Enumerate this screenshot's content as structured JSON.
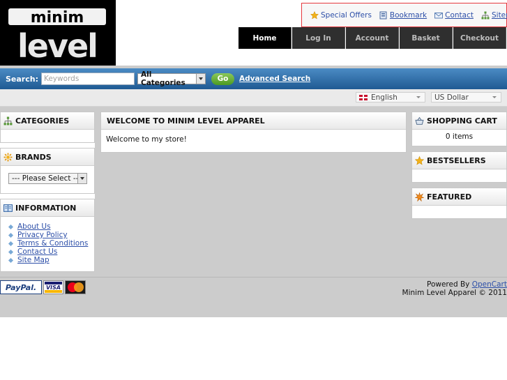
{
  "logo": {
    "line1": "minim",
    "line2": "level"
  },
  "toplinks": [
    {
      "label": "Special Offers",
      "icon": "star-icon"
    },
    {
      "label": "Bookmark",
      "icon": "bookmark-icon"
    },
    {
      "label": "Contact",
      "icon": "envelope-icon"
    },
    {
      "label": "Sitemap",
      "icon": "sitemap-icon"
    }
  ],
  "nav": {
    "home": "Home",
    "login": "Log In",
    "account": "Account",
    "basket": "Basket",
    "checkout": "Checkout"
  },
  "search": {
    "label": "Search:",
    "placeholder": "Keywords",
    "category": "All Categories",
    "go": "Go",
    "advanced": "Advanced Search"
  },
  "language": "English",
  "currency": "US Dollar",
  "left": {
    "categories_title": "CATEGORIES",
    "brands_title": "BRANDS",
    "brands_select": "--- Please Select ---",
    "info_title": "INFORMATION",
    "info_links": [
      "About Us",
      "Privacy Policy",
      "Terms & Conditions",
      "Contact Us",
      "Site Map"
    ]
  },
  "welcome": {
    "title": "WELCOME TO MINIM LEVEL APPAREL",
    "text": "Welcome to my store!"
  },
  "right": {
    "cart_title": "SHOPPING CART",
    "cart_items": "0 items",
    "bestsellers_title": "BESTSELLERS",
    "featured_title": "FEATURED"
  },
  "footer": {
    "paypal": "PayPal.",
    "visa": "VISA",
    "powered_by": "Powered By",
    "opencart": "OpenCart",
    "copyright": "Minim Level Apparel © 2011"
  },
  "colors": {
    "link": "#2d4fa8",
    "search_bar": "#2f6ba8",
    "go_button": "#5aab2c",
    "highlight_border": "#e6373d"
  }
}
